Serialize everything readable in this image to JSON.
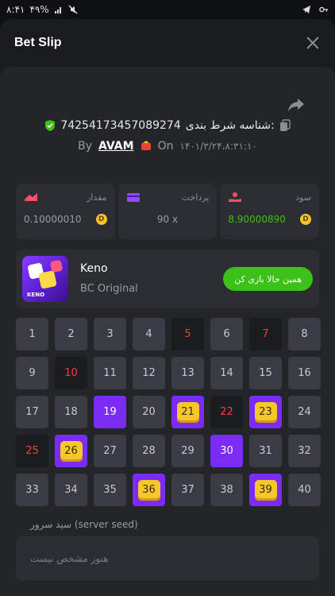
{
  "status_bar": {
    "time": "۸:۴۱",
    "battery": "۴۹%"
  },
  "header": {
    "title": "Bet Slip"
  },
  "bet": {
    "id_label": "شناسه شرط بندی:",
    "id_value": "74254173457089274",
    "by": "By",
    "user": "AVAM",
    "on": "On",
    "date": "۱۴۰۱/۳/۲۴،۸:۳۱:۱۰"
  },
  "stats": [
    {
      "label": "مقدار",
      "value": "0.10000010",
      "icon": "bet-amount-icon",
      "highlight": false
    },
    {
      "label": "پرداخت",
      "value": "90 x",
      "icon": "payout-card-icon",
      "highlight": false
    },
    {
      "label": "سود",
      "value": "8.90000890",
      "icon": "profit-hand-icon",
      "highlight": true
    }
  ],
  "coin_symbol": "D",
  "game": {
    "name": "Keno",
    "subtitle": "BC Original",
    "thumb_label": "KENO",
    "play_button": "همین حالا بازی کن"
  },
  "numbers": [
    {
      "n": "1",
      "s": "n"
    },
    {
      "n": "2",
      "s": "n"
    },
    {
      "n": "3",
      "s": "n"
    },
    {
      "n": "4",
      "s": "n"
    },
    {
      "n": "5",
      "s": "m"
    },
    {
      "n": "6",
      "s": "n"
    },
    {
      "n": "7",
      "s": "m"
    },
    {
      "n": "8",
      "s": "n"
    },
    {
      "n": "9",
      "s": "n"
    },
    {
      "n": "10",
      "s": "m"
    },
    {
      "n": "11",
      "s": "n"
    },
    {
      "n": "12",
      "s": "n"
    },
    {
      "n": "13",
      "s": "n"
    },
    {
      "n": "14",
      "s": "n"
    },
    {
      "n": "15",
      "s": "n"
    },
    {
      "n": "16",
      "s": "n"
    },
    {
      "n": "17",
      "s": "n"
    },
    {
      "n": "18",
      "s": "n"
    },
    {
      "n": "19",
      "s": "p"
    },
    {
      "n": "20",
      "s": "n"
    },
    {
      "n": "21",
      "s": "h"
    },
    {
      "n": "22",
      "s": "m"
    },
    {
      "n": "23",
      "s": "h"
    },
    {
      "n": "24",
      "s": "n"
    },
    {
      "n": "25",
      "s": "m"
    },
    {
      "n": "26",
      "s": "h"
    },
    {
      "n": "27",
      "s": "n"
    },
    {
      "n": "28",
      "s": "n"
    },
    {
      "n": "29",
      "s": "n"
    },
    {
      "n": "30",
      "s": "p"
    },
    {
      "n": "31",
      "s": "n"
    },
    {
      "n": "32",
      "s": "n"
    },
    {
      "n": "33",
      "s": "n"
    },
    {
      "n": "34",
      "s": "n"
    },
    {
      "n": "35",
      "s": "n"
    },
    {
      "n": "36",
      "s": "h"
    },
    {
      "n": "37",
      "s": "n"
    },
    {
      "n": "38",
      "s": "n"
    },
    {
      "n": "39",
      "s": "h"
    },
    {
      "n": "40",
      "s": "n"
    }
  ],
  "seed": {
    "label": "سید سرور (server seed)",
    "placeholder": "هنوز مشخص نیست"
  },
  "colors": {
    "accent_purple": "#7b2cf4",
    "win_green": "#3bc117",
    "miss_red": "#ff3b3b",
    "coin_gold": "#f7c331"
  }
}
